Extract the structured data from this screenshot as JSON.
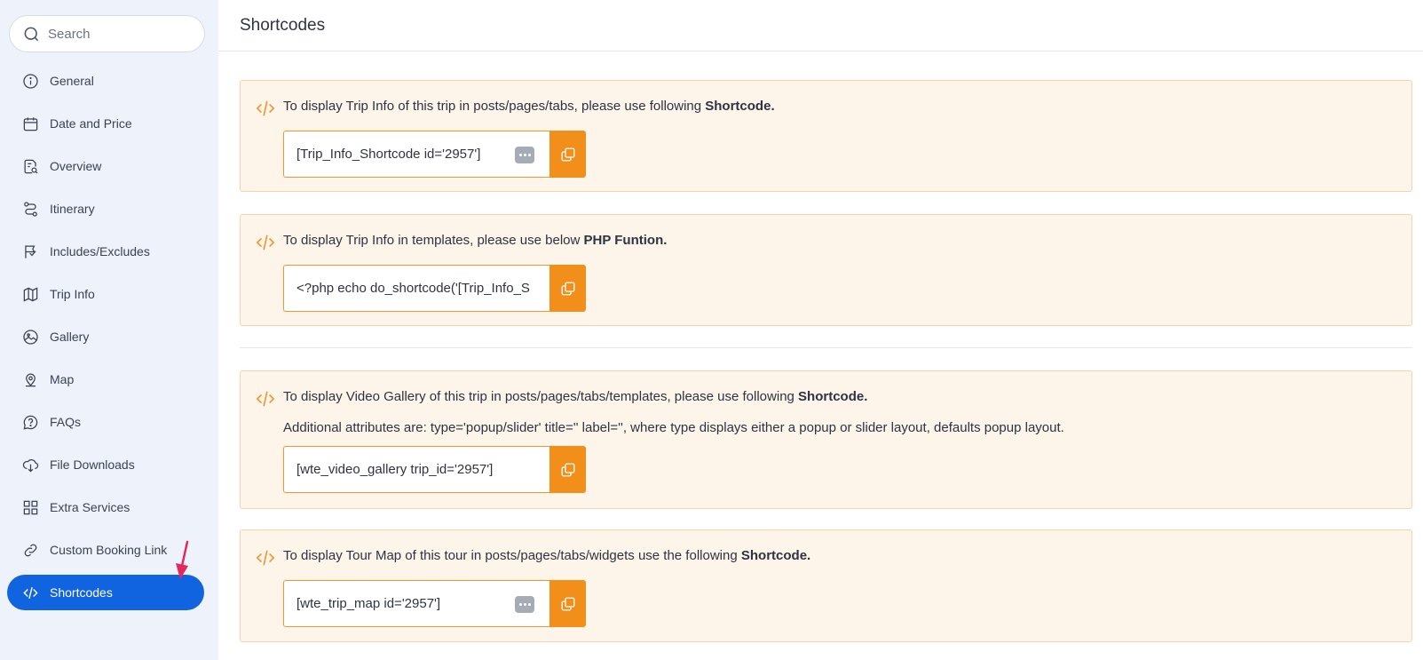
{
  "sidebar": {
    "search": {
      "placeholder": "Search"
    },
    "items": [
      {
        "label": "General",
        "icon": "info-icon"
      },
      {
        "label": "Date and Price",
        "icon": "calendar-icon"
      },
      {
        "label": "Overview",
        "icon": "document-search-icon"
      },
      {
        "label": "Itinerary",
        "icon": "route-icon"
      },
      {
        "label": "Includes/Excludes",
        "icon": "flag-icon"
      },
      {
        "label": "Trip Info",
        "icon": "map-icon"
      },
      {
        "label": "Gallery",
        "icon": "image-icon"
      },
      {
        "label": "Map",
        "icon": "map-pin-icon"
      },
      {
        "label": "FAQs",
        "icon": "help-icon"
      },
      {
        "label": "File Downloads",
        "icon": "download-icon"
      },
      {
        "label": "Extra Services",
        "icon": "grid-icon"
      },
      {
        "label": "Custom Booking Link",
        "icon": "link-icon"
      },
      {
        "label": "Shortcodes",
        "icon": "code-icon",
        "active": true
      }
    ]
  },
  "header": {
    "title": "Shortcodes"
  },
  "cards": [
    {
      "text_before": "To display Trip Info of this trip in posts/pages/tabs, please use following ",
      "text_bold": "Shortcode.",
      "value": "[Trip_Info_Shortcode id='2957']"
    },
    {
      "text_before": "To display Trip Info in templates, please use below ",
      "text_bold": "PHP Funtion.",
      "value": "<?php echo do_shortcode('[Trip_Info_S"
    },
    {
      "text_before": "To display Video Gallery of this trip in posts/pages/tabs/templates, please use following ",
      "text_bold": "Shortcode.",
      "subtext": "Additional attributes are: type='popup/slider' title='' label='', where type displays either a popup or slider layout, defaults popup layout.",
      "value": "[wte_video_gallery trip_id='2957']"
    },
    {
      "text_before": "To display Tour Map of this tour in posts/pages/tabs/widgets use the following ",
      "text_bold": "Shortcode.",
      "value": "[wte_trip_map id='2957']"
    }
  ],
  "colors": {
    "accent": "#f18f1a",
    "active_nav": "#1164e0",
    "card_bg": "#fdf4ea",
    "sidebar_bg": "#edf2fb"
  }
}
